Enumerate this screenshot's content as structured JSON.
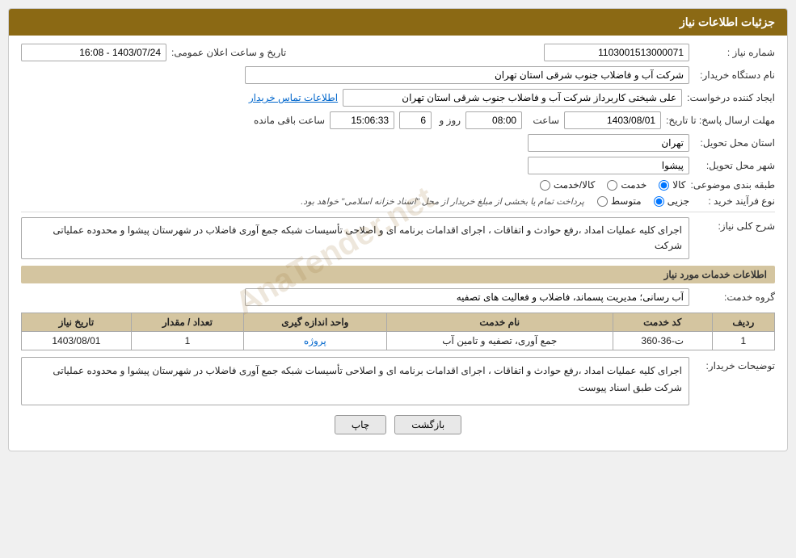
{
  "header": {
    "title": "جزئیات اطلاعات نیاز"
  },
  "form": {
    "shomara_niaz_label": "شماره نیاز :",
    "shomara_niaz_value": "1103001513000071",
    "nam_dastgah_label": "نام دستگاه خریدار:",
    "nam_dastgah_value": "شرکت آب و فاضلاب جنوب شرقی استان تهران",
    "ejad_label": "ایجاد کننده درخواست:",
    "ejad_value": "علی شیختی کاربرداز شرکت آب و فاضلاب جنوب شرقی استان تهران",
    "ejad_link": "اطلاعات تماس خریدار",
    "mohlet_label": "مهلت ارسال پاسخ: تا تاریخ:",
    "mohlet_date": "1403/08/01",
    "mohlet_saat": "08:00",
    "mohlet_roz": "6",
    "mohlet_time": "15:06:33",
    "mohlet_baqui": "ساعت باقی مانده",
    "tarikh_label": "تاریخ و ساعت اعلان عمومی:",
    "tarikh_value": "1403/07/24 - 16:08",
    "ostan_label": "استان محل تحویل:",
    "ostan_value": "تهران",
    "shahr_label": "شهر محل تحویل:",
    "shahr_value": "پیشوا",
    "tabaqe_label": "طبقه بندی موضوعی:",
    "radio_kala": "کالا",
    "radio_khadamat": "خدمت",
    "radio_kala_khadamat": "کالا/خدمت",
    "nove_label": "نوع فرآیند خرید :",
    "radio_jozii": "جزیی",
    "radio_motavasset": "متوسط",
    "note_text": "پرداخت تمام یا بخشی از مبلغ خریدار از محل \"اسناد خزانه اسلامی\" خواهد بود.",
    "sharh_label": "شرح کلی نیاز:",
    "sharh_value": "اجرای کلیه عملیات امداد ،رفع حوادث و اتفاقات ، اجرای اقدامات برنامه ای و اصلاحی تأسیسات شبکه جمع آوری فاضلاب در شهرستان پیشوا و محدوده عملیاتی شرکت",
    "khadamat_section": "اطلاعات خدمات مورد نیاز",
    "gorohe_label": "گروه خدمت:",
    "gorohe_value": "آب رسانی؛ مدیریت پسماند، فاضلاب و فعالیت های تصفیه",
    "table": {
      "headers": [
        "ردیف",
        "کد خدمت",
        "نام خدمت",
        "واحد اندازه گیری",
        "تعداد / مقدار",
        "تاریخ نیاز"
      ],
      "rows": [
        {
          "radif": "1",
          "kod": "ت-36-360",
          "nam": "جمع آوری، تصفیه و تامین آب",
          "vahed": "پروژه",
          "tedad": "1",
          "tarikh": "1403/08/01"
        }
      ]
    },
    "tawsihat_label": "توضیحات خریدار:",
    "tawsihat_value": "اجرای کلیه عملیات امداد ،رفع حوادث و اتفاقات ، اجرای اقدامات برنامه ای و اصلاحی تأسیسات شبکه جمع آوری فاضلاب در شهرستان پیشوا و محدوده عملیاتی شرکت طبق اسناد پیوست"
  },
  "buttons": {
    "print": "چاپ",
    "back": "بازگشت"
  },
  "watermark": "AnaTender.net"
}
